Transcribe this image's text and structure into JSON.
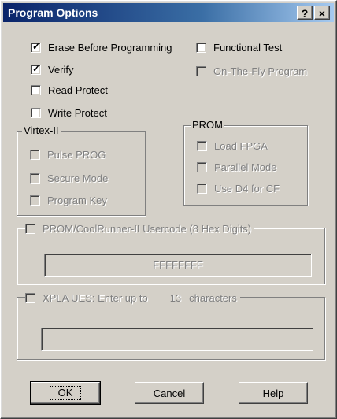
{
  "window": {
    "title": "Program Options",
    "help_label": "?",
    "close_label": "×"
  },
  "options": {
    "erase": {
      "label": "Erase Before Programming",
      "checked": true
    },
    "verify": {
      "label": "Verify",
      "checked": true
    },
    "read_protect": {
      "label": "Read Protect",
      "checked": false
    },
    "write_protect": {
      "label": "Write Protect",
      "checked": false
    },
    "functional_test": {
      "label": "Functional Test",
      "checked": false
    },
    "on_the_fly": {
      "label": "On-The-Fly Program",
      "checked": false,
      "enabled": false
    }
  },
  "virtex": {
    "title": "Virtex-II",
    "pulse_prog": "Pulse PROG",
    "secure_mode": "Secure Mode",
    "program_key": "Program Key"
  },
  "prom": {
    "title": "PROM",
    "load_fpga": "Load FPGA",
    "parallel_mode": "Parallel Mode",
    "use_d4": "Use D4 for CF"
  },
  "usercode": {
    "label": "PROM/CoolRunner-II Usercode (8 Hex Digits)",
    "value": "FFFFFFFF"
  },
  "xpla": {
    "label_prefix": "XPLA UES: Enter up to",
    "count": "13",
    "label_suffix": "characters",
    "value": ""
  },
  "buttons": {
    "ok": "OK",
    "cancel": "Cancel",
    "help": "Help"
  },
  "colors": {
    "title_start": "#0a246a",
    "title_end": "#a6caf0",
    "face": "#d4d0c8",
    "disabled_text": "#808080"
  }
}
